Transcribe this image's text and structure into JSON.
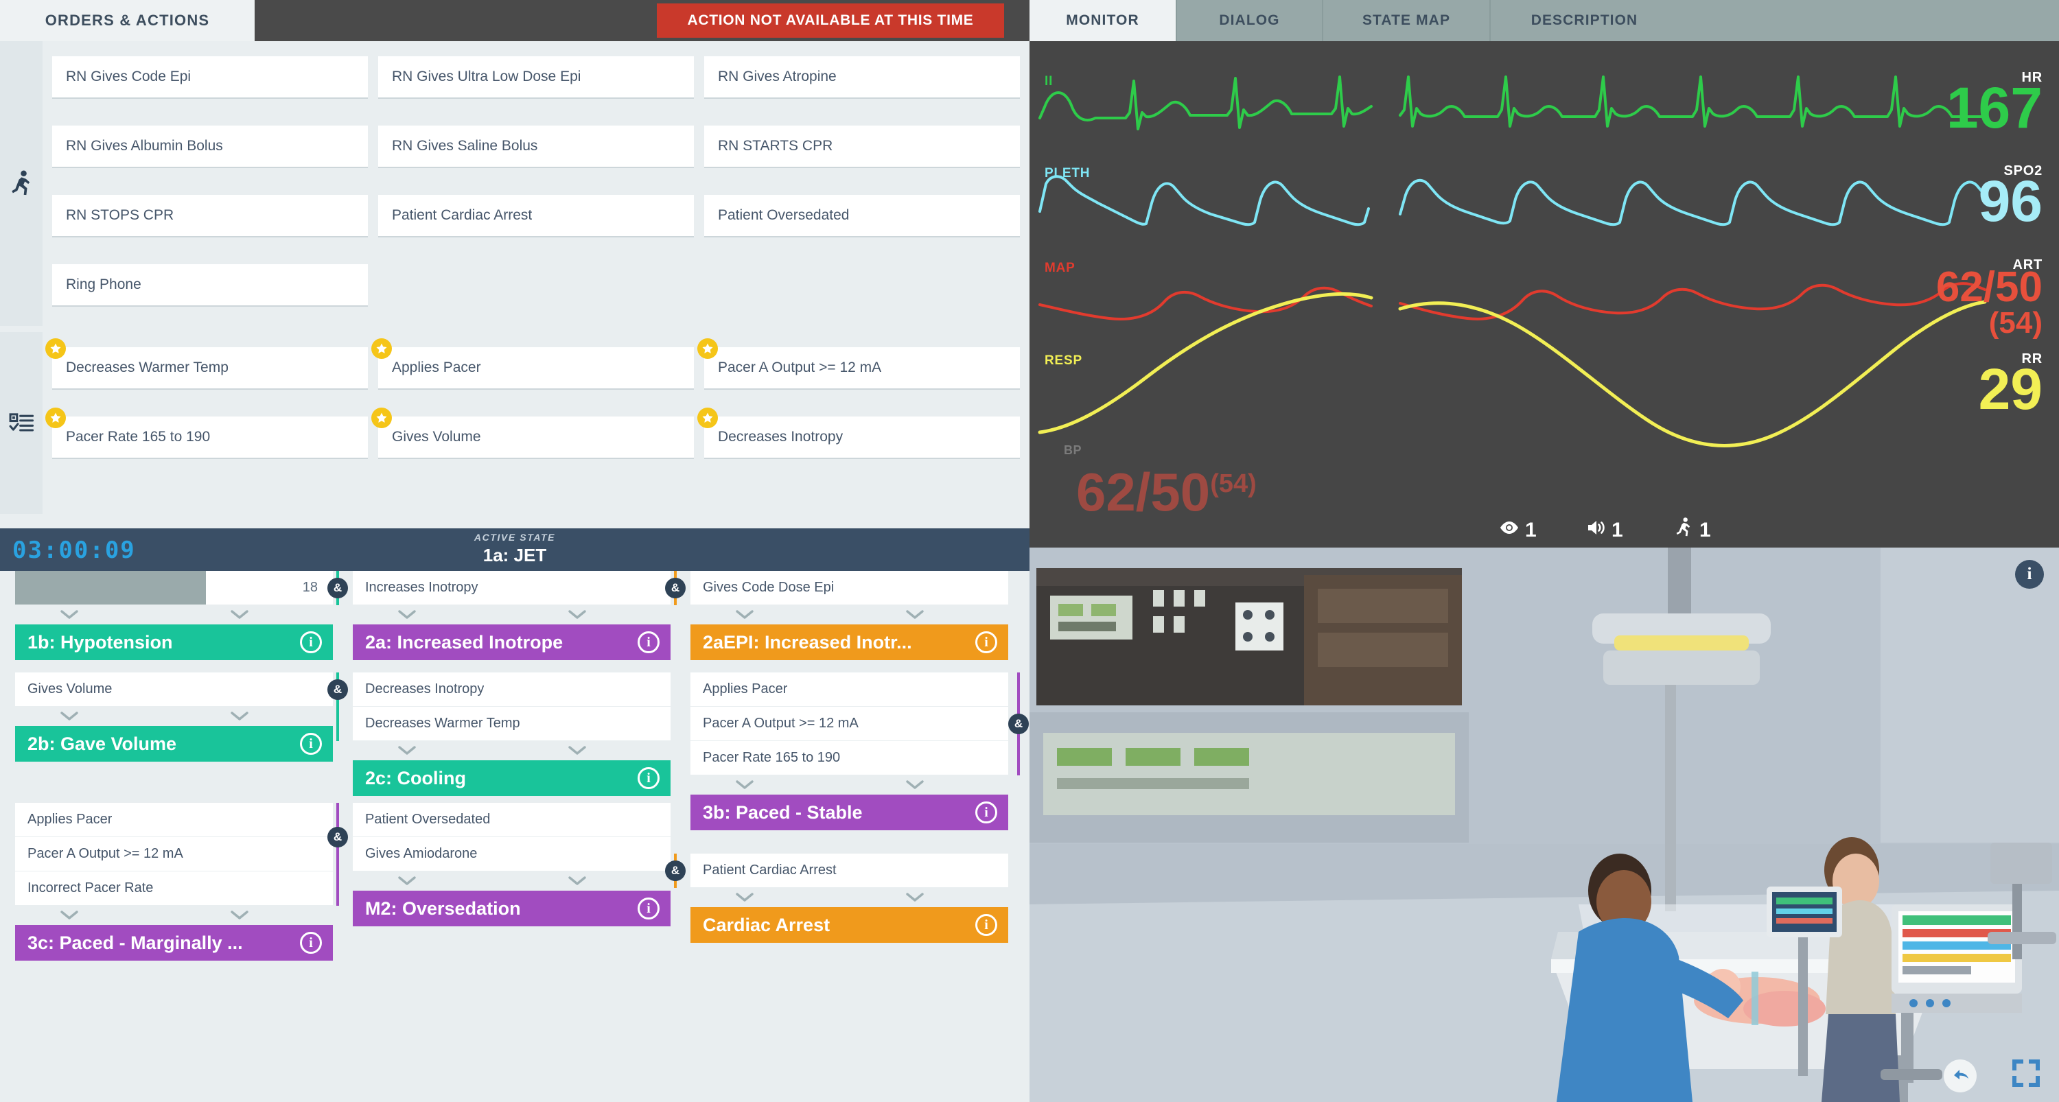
{
  "left": {
    "tab_label": "ORDERS & ACTIONS",
    "action_banner": "ACTION NOT AVAILABLE AT THIS TIME",
    "rail": {
      "actions_icon": "running-person-icon",
      "checks_icon": "checklist-icon"
    },
    "orders": [
      "RN Gives Code Epi",
      "RN Gives Ultra Low Dose Epi",
      "RN Gives Atropine",
      "RN Gives Albumin Bolus",
      "RN Gives Saline Bolus",
      "RN STARTS CPR",
      "RN STOPS CPR",
      "Patient Cardiac Arrest",
      "Patient Oversedated",
      "Ring Phone"
    ],
    "checks": [
      "Decreases Warmer Temp",
      "Applies Pacer",
      "Pacer A Output >= 12 mA",
      "Pacer Rate 165 to 190",
      "Gives Volume",
      "Decreases Inotropy"
    ],
    "state_bar": {
      "clock": "03:00:09",
      "active_state_caption": "ACTIVE STATE",
      "active_state_name": "1a: JET"
    }
  },
  "flow": {
    "col1": {
      "progress_value": "18",
      "progress_percent": 60,
      "state_1b": "1b: Hypotension",
      "trigger_gives_volume": "Gives Volume",
      "state_2b": "2b: Gave Volume",
      "trigger_applies_pacer": "Applies Pacer",
      "trigger_pacer_output": "Pacer A Output >= 12 mA",
      "trigger_incorrect_rate": "Incorrect Pacer Rate",
      "state_3c": "3c: Paced - Marginally ..."
    },
    "col2": {
      "trigger_increases_inotropy": "Increases Inotropy",
      "state_2a": "2a: Increased Inotrope",
      "trigger_decreases_inotropy": "Decreases Inotropy",
      "trigger_decreases_warmer": "Decreases Warmer Temp",
      "state_2c": "2c: Cooling",
      "trigger_oversedated": "Patient Oversedated",
      "trigger_amiodarone": "Gives Amiodarone",
      "state_m2": "M2: Oversedation"
    },
    "col3": {
      "trigger_code_epi": "Gives Code Dose Epi",
      "state_2aepi": "2aEPI: Increased Inotr...",
      "trigger_applies_pacer": "Applies Pacer",
      "trigger_pacer_output": "Pacer A Output >= 12 mA",
      "trigger_pacer_rate": "Pacer Rate 165 to 190",
      "state_3b": "3b: Paced - Stable",
      "trigger_cardiac_arrest": "Patient Cardiac Arrest",
      "state_cardiac_arrest": "Cardiac Arrest"
    },
    "and_symbol": "&",
    "info_symbol": "i",
    "colors": {
      "green": "#19c49a",
      "purple": "#a14cc0",
      "orange": "#f09a1c",
      "and_pill": "#2e4256"
    }
  },
  "right": {
    "tabs": [
      {
        "label": "MONITOR",
        "active": true
      },
      {
        "label": "DIALOG",
        "active": false
      },
      {
        "label": "STATE MAP",
        "active": false
      },
      {
        "label": "DESCRIPTION",
        "active": false
      }
    ],
    "monitor": {
      "waves": [
        {
          "label": "II",
          "color": "#2ecc4a"
        },
        {
          "label": "PLETH",
          "color": "#7fe6f5"
        },
        {
          "label": "MAP",
          "color": "#e23b2e"
        },
        {
          "label": "RESP",
          "color": "#f2ef55"
        }
      ],
      "vitals": [
        {
          "label": "HR",
          "value": "167",
          "sub": "",
          "color": "#2ecc4a"
        },
        {
          "label": "SPO2",
          "value": "96",
          "sub": "",
          "color": "#a6ecf7"
        },
        {
          "label": "ART",
          "value": "62/50",
          "sub": "(54)",
          "color": "#e8503c"
        },
        {
          "label": "RR",
          "value": "29",
          "sub": "",
          "color": "#f2ef55"
        }
      ],
      "bp": {
        "label": "BP",
        "value": "62/50",
        "mean": "(54)"
      },
      "counters": [
        {
          "icon": "eye-icon",
          "value": "1"
        },
        {
          "icon": "speaker-icon",
          "value": "1"
        },
        {
          "icon": "running-person-icon",
          "value": "1"
        }
      ]
    },
    "scene": {
      "info_symbol": "i",
      "undo_icon": "undo-arrow-icon",
      "fullscreen_icon": "fullscreen-icon"
    }
  }
}
